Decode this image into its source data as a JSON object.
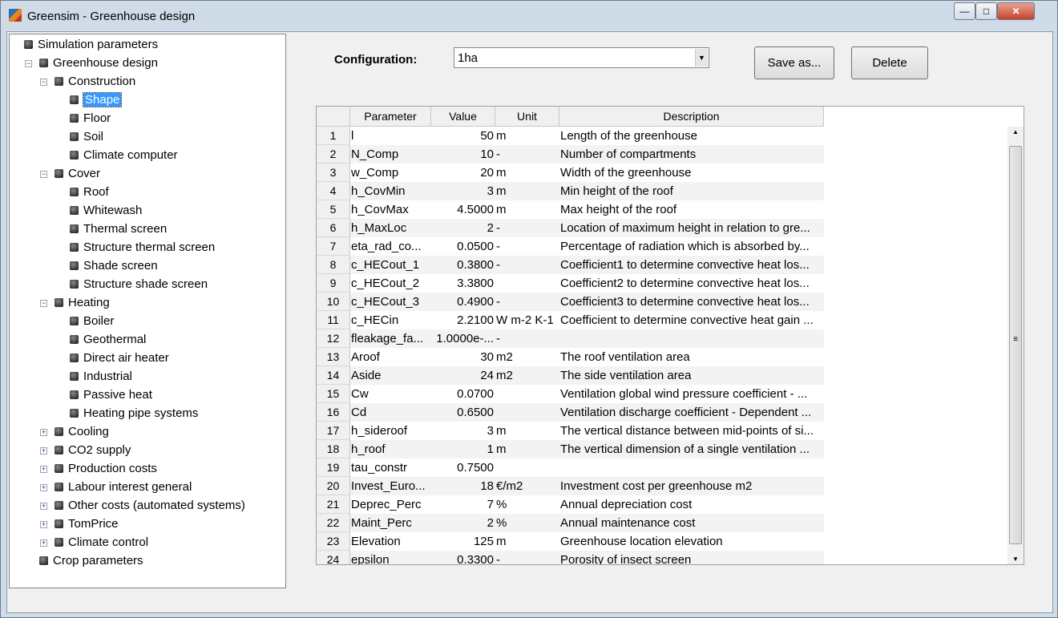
{
  "window": {
    "title": "Greensim - Greenhouse design",
    "minimize": "—",
    "maximize": "□",
    "close": "✕"
  },
  "tree": [
    {
      "label": "Simulation parameters",
      "level": 0,
      "expander": ""
    },
    {
      "label": "Greenhouse design",
      "level": 1,
      "expander": "−"
    },
    {
      "label": "Construction",
      "level": 2,
      "expander": "−"
    },
    {
      "label": "Shape",
      "level": 3,
      "expander": "",
      "selected": true
    },
    {
      "label": "Floor",
      "level": 3,
      "expander": ""
    },
    {
      "label": "Soil",
      "level": 3,
      "expander": ""
    },
    {
      "label": "Climate computer",
      "level": 3,
      "expander": ""
    },
    {
      "label": "Cover",
      "level": 2,
      "expander": "−"
    },
    {
      "label": "Roof",
      "level": 3,
      "expander": ""
    },
    {
      "label": "Whitewash",
      "level": 3,
      "expander": ""
    },
    {
      "label": "Thermal screen",
      "level": 3,
      "expander": ""
    },
    {
      "label": "Structure thermal screen",
      "level": 3,
      "expander": ""
    },
    {
      "label": "Shade screen",
      "level": 3,
      "expander": ""
    },
    {
      "label": "Structure shade screen",
      "level": 3,
      "expander": ""
    },
    {
      "label": "Heating",
      "level": 2,
      "expander": "−"
    },
    {
      "label": "Boiler",
      "level": 3,
      "expander": ""
    },
    {
      "label": "Geothermal",
      "level": 3,
      "expander": ""
    },
    {
      "label": "Direct air heater",
      "level": 3,
      "expander": ""
    },
    {
      "label": "Industrial",
      "level": 3,
      "expander": ""
    },
    {
      "label": "Passive heat",
      "level": 3,
      "expander": ""
    },
    {
      "label": "Heating pipe systems",
      "level": 3,
      "expander": ""
    },
    {
      "label": "Cooling",
      "level": 2,
      "expander": "+"
    },
    {
      "label": "CO2 supply",
      "level": 2,
      "expander": "+"
    },
    {
      "label": "Production costs",
      "level": 2,
      "expander": "+"
    },
    {
      "label": "Labour interest general",
      "level": 2,
      "expander": "+"
    },
    {
      "label": "Other costs (automated systems)",
      "level": 2,
      "expander": "+"
    },
    {
      "label": "TomPrice",
      "level": 2,
      "expander": "+"
    },
    {
      "label": "Climate control",
      "level": 2,
      "expander": "+"
    },
    {
      "label": "Crop parameters",
      "level": 1,
      "expander": ""
    }
  ],
  "config": {
    "label": "Configuration:",
    "value": "1ha",
    "save_as": "Save as...",
    "delete": "Delete"
  },
  "table": {
    "headers": [
      "Parameter",
      "Value",
      "Unit",
      "Description"
    ],
    "rows": [
      [
        "1",
        "l",
        "50",
        "m",
        "Length of the greenhouse"
      ],
      [
        "2",
        "N_Comp",
        "10",
        "-",
        "Number of compartments"
      ],
      [
        "3",
        "w_Comp",
        "20",
        "m",
        "Width of the greenhouse"
      ],
      [
        "4",
        "h_CovMin",
        "3",
        "m",
        "Min height of the roof"
      ],
      [
        "5",
        "h_CovMax",
        "4.5000",
        "m",
        "Max height of the roof"
      ],
      [
        "6",
        "h_MaxLoc",
        "2",
        "-",
        "Location of maximum height in relation to gre..."
      ],
      [
        "7",
        "eta_rad_co...",
        "0.0500",
        "-",
        "Percentage of radiation which is absorbed by..."
      ],
      [
        "8",
        "c_HECout_1",
        "0.3800",
        "-",
        "Coefficient1 to determine convective heat los..."
      ],
      [
        "9",
        "c_HECout_2",
        "3.3800",
        "",
        "Coefficient2 to determine convective heat los..."
      ],
      [
        "10",
        "c_HECout_3",
        "0.4900",
        "-",
        "Coefficient3 to determine convective heat los..."
      ],
      [
        "11",
        "c_HECin",
        "2.2100",
        "W m-2 K-1",
        "Coefficient to determine convective heat gain ..."
      ],
      [
        "12",
        "fleakage_fa...",
        "1.0000e-...",
        "-",
        ""
      ],
      [
        "13",
        "Aroof",
        "30",
        "m2",
        "The roof ventilation area"
      ],
      [
        "14",
        "Aside",
        "24",
        "m2",
        "The side ventilation area"
      ],
      [
        "15",
        "Cw",
        "0.0700",
        "",
        "Ventilation global wind pressure coefficient - ..."
      ],
      [
        "16",
        "Cd",
        "0.6500",
        "",
        "Ventilation discharge coefficient - Dependent ..."
      ],
      [
        "17",
        "h_sideroof",
        "3",
        "m",
        "The vertical distance between mid-points of si..."
      ],
      [
        "18",
        "h_roof",
        "1",
        "m",
        "The vertical dimension of a single ventilation ..."
      ],
      [
        "19",
        "tau_constr",
        "0.7500",
        "",
        ""
      ],
      [
        "20",
        "Invest_Euro...",
        "18",
        "€/m2",
        "Investment cost per greenhouse m2"
      ],
      [
        "21",
        "Deprec_Perc",
        "7",
        "%",
        "Annual depreciation cost"
      ],
      [
        "22",
        "Maint_Perc",
        "2",
        "%",
        "Annual maintenance cost"
      ],
      [
        "23",
        "Elevation",
        "125",
        "m",
        "Greenhouse location elevation"
      ],
      [
        "24",
        "epsilon",
        "0.3300",
        "-",
        "Porosity of insect screen"
      ]
    ]
  },
  "colors": {
    "selection": "#3399ff",
    "row_alt": "#f3f3f3"
  }
}
